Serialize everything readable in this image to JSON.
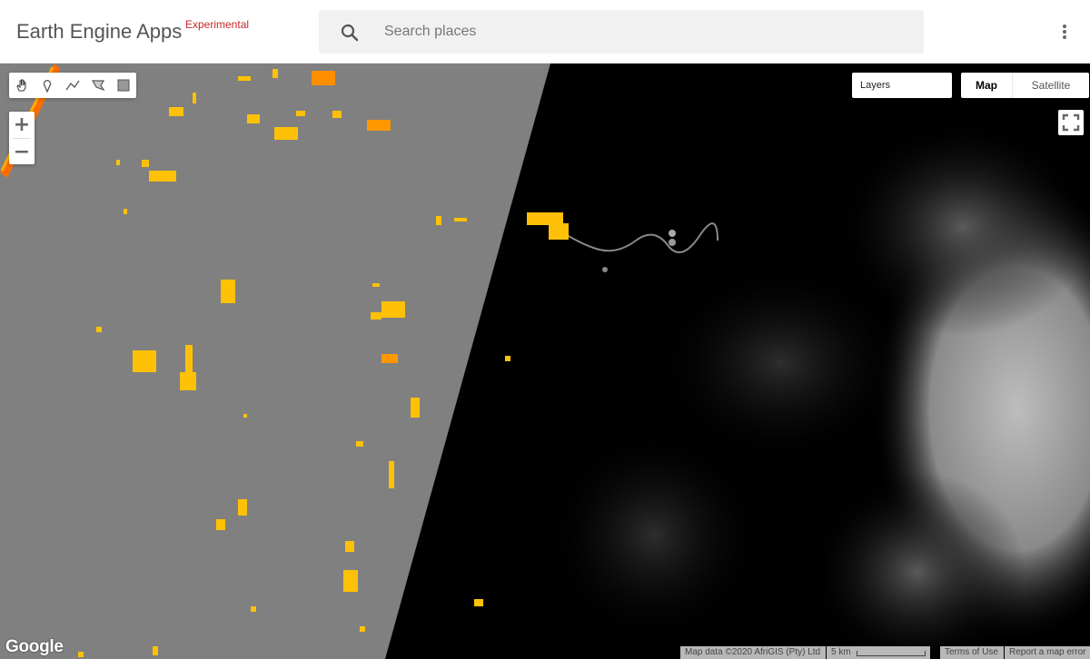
{
  "header": {
    "title": "Earth Engine Apps",
    "badge": "Experimental",
    "search": {
      "placeholder": "Search places",
      "value": ""
    },
    "search_icon": "search-icon",
    "menu_icon": "more-vert-icon"
  },
  "map": {
    "drawing_tools": [
      "hand-icon",
      "marker-icon",
      "line-icon",
      "polygon-icon",
      "rectangle-icon"
    ],
    "zoom_in_label": "+",
    "zoom_out_label": "−",
    "layers_label": "Layers",
    "map_type": {
      "map_label": "Map",
      "satellite_label": "Satellite",
      "selected": "Map"
    },
    "fullscreen_icon": "fullscreen-icon",
    "footer": {
      "logo": "Google",
      "map_data": "Map data ©2020 AfriGIS (Pty) Ltd",
      "scale": "5 km",
      "terms": "Terms of Use",
      "report": "Report a map error"
    },
    "colors": {
      "gray_tile": "#808080",
      "dark_tile": "#000000",
      "highlight_yellow": "#ffc107",
      "highlight_orange": "#ff6d00"
    }
  }
}
